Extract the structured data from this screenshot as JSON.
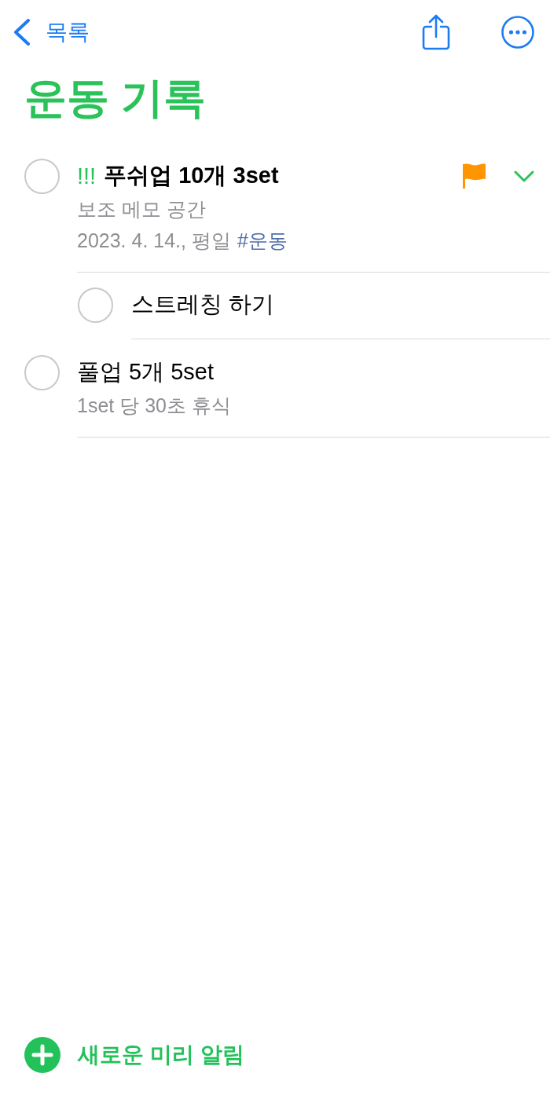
{
  "nav": {
    "back_label": "목록"
  },
  "title": "운동 기록",
  "reminders": [
    {
      "priority": "!!!",
      "title": "푸쉬업 10개 3set",
      "checked": false,
      "flagged": true,
      "expanded": true,
      "notes": "보조 메모 공간",
      "date": "2023. 4. 14., 평일",
      "tag": "#운동",
      "children": [
        {
          "title": "스트레칭 하기",
          "checked": false,
          "flagged": false
        }
      ]
    },
    {
      "title": "풀업 5개 5set",
      "checked": false,
      "flagged": false,
      "notes": "1set 당 30초 휴식"
    }
  ],
  "new_reminder": {
    "label": "새로운 미리 알림"
  }
}
